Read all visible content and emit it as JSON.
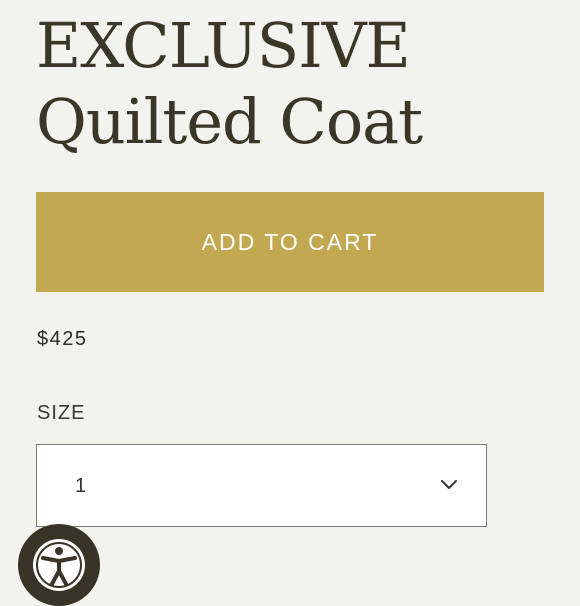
{
  "product": {
    "title_line1": "EXCLUSIVE",
    "title_line2": "Quilted Coat",
    "price": "$425"
  },
  "actions": {
    "add_to_cart_label": "ADD TO CART"
  },
  "size": {
    "label": "SIZE",
    "selected_value": "1"
  },
  "colors": {
    "background": "#f2f2ee",
    "accent_gold": "#c2a951",
    "title_text": "#3a3628",
    "accessibility_button": "#3a3426"
  },
  "icons": {
    "dropdown": "chevron-down-icon",
    "accessibility": "accessibility-icon"
  }
}
